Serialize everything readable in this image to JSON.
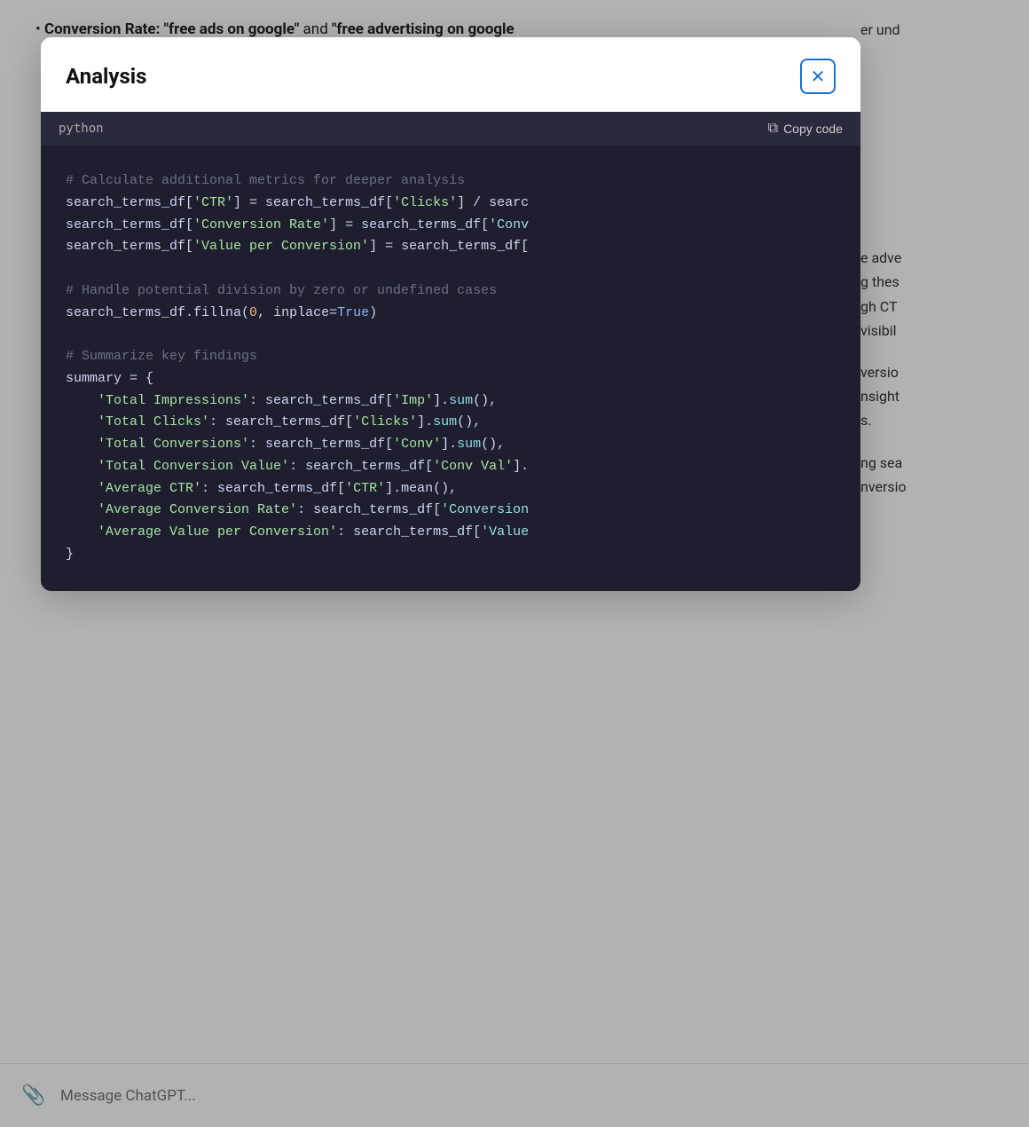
{
  "background": {
    "bullet_text": "Conversion Rate: \"free ads on google\" and \"free advertising on google\"",
    "right_snippets": [
      "e adve",
      "g thes",
      "gh CT",
      "visibil",
      "versio",
      "nsight",
      "s.",
      "ng sea",
      "nversio"
    ]
  },
  "modal": {
    "title": "Analysis",
    "close_label": "×",
    "code_header": {
      "lang": "python",
      "copy_label": "Copy code"
    },
    "code_lines": [
      {
        "type": "comment",
        "text": "# Calculate additional metrics for deeper analysis"
      },
      {
        "type": "mixed",
        "parts": [
          {
            "t": "default",
            "v": "search_terms_df["
          },
          {
            "t": "string-green",
            "v": "'CTR'"
          },
          {
            "t": "default",
            "v": "] = search_terms_df["
          },
          {
            "t": "string-green",
            "v": "'Clicks'"
          },
          {
            "t": "default",
            "v": "] / searc"
          }
        ]
      },
      {
        "type": "mixed",
        "parts": [
          {
            "t": "default",
            "v": "search_terms_df["
          },
          {
            "t": "string-green",
            "v": "'Conversion Rate'"
          },
          {
            "t": "default",
            "v": "] = search_terms_df["
          },
          {
            "t": "string-teal",
            "v": "'Conv"
          }
        ]
      },
      {
        "type": "mixed",
        "parts": [
          {
            "t": "default",
            "v": "search_terms_df["
          },
          {
            "t": "string-green",
            "v": "'Value per Conversion'"
          },
          {
            "t": "default",
            "v": "] = search_terms_df["
          }
        ]
      },
      {
        "type": "blank",
        "text": ""
      },
      {
        "type": "comment",
        "text": "# Handle potential division by zero or undefined cases"
      },
      {
        "type": "mixed",
        "parts": [
          {
            "t": "default",
            "v": "search_terms_df.fillna("
          },
          {
            "t": "orange",
            "v": "0"
          },
          {
            "t": "default",
            "v": ", inplace="
          },
          {
            "t": "keyword-blue",
            "v": "True"
          },
          {
            "t": "default",
            "v": ")"
          }
        ]
      },
      {
        "type": "blank",
        "text": ""
      },
      {
        "type": "comment",
        "text": "# Summarize key findings"
      },
      {
        "type": "default",
        "text": "summary = {"
      },
      {
        "type": "mixed",
        "parts": [
          {
            "t": "indent",
            "v": "    "
          },
          {
            "t": "string-green",
            "v": "'Total Impressions'"
          },
          {
            "t": "default",
            "v": ": search_terms_df["
          },
          {
            "t": "string-green",
            "v": "'Imp'"
          },
          {
            "t": "default",
            "v": "]."
          },
          {
            "t": "method",
            "v": "sum"
          },
          {
            "t": "default",
            "v": "(),"
          }
        ]
      },
      {
        "type": "mixed",
        "parts": [
          {
            "t": "indent",
            "v": "    "
          },
          {
            "t": "string-green",
            "v": "'Total Clicks'"
          },
          {
            "t": "default",
            "v": ": search_terms_df["
          },
          {
            "t": "string-green",
            "v": "'Clicks'"
          },
          {
            "t": "default",
            "v": "]."
          },
          {
            "t": "method",
            "v": "sum"
          },
          {
            "t": "default",
            "v": "(),"
          }
        ]
      },
      {
        "type": "mixed",
        "parts": [
          {
            "t": "indent",
            "v": "    "
          },
          {
            "t": "string-green",
            "v": "'Total Conversions'"
          },
          {
            "t": "default",
            "v": ": search_terms_df["
          },
          {
            "t": "string-green",
            "v": "'Conv'"
          },
          {
            "t": "default",
            "v": "]."
          },
          {
            "t": "method",
            "v": "sum"
          },
          {
            "t": "default",
            "v": "(),"
          }
        ]
      },
      {
        "type": "mixed",
        "parts": [
          {
            "t": "indent",
            "v": "    "
          },
          {
            "t": "string-green",
            "v": "'Total Conversion Value'"
          },
          {
            "t": "default",
            "v": ": search_terms_df["
          },
          {
            "t": "string-green",
            "v": "'Conv Val'"
          },
          {
            "t": "default",
            "v": "]."
          }
        ]
      },
      {
        "type": "mixed",
        "parts": [
          {
            "t": "indent",
            "v": "    "
          },
          {
            "t": "string-green",
            "v": "'Average CTR'"
          },
          {
            "t": "default",
            "v": ": search_terms_df["
          },
          {
            "t": "string-green",
            "v": "'CTR'"
          },
          {
            "t": "default",
            "v": "].mean(),"
          }
        ]
      },
      {
        "type": "mixed",
        "parts": [
          {
            "t": "indent",
            "v": "    "
          },
          {
            "t": "string-green",
            "v": "'Average Conversion Rate'"
          },
          {
            "t": "default",
            "v": ": search_terms_df["
          },
          {
            "t": "string-teal",
            "v": "'Conversion"
          }
        ]
      },
      {
        "type": "mixed",
        "parts": [
          {
            "t": "indent",
            "v": "    "
          },
          {
            "t": "string-green",
            "v": "'Average Value per Conversion'"
          },
          {
            "t": "default",
            "v": ": search_terms_df["
          },
          {
            "t": "string-teal",
            "v": "'Value"
          }
        ]
      },
      {
        "type": "default",
        "text": "}"
      }
    ]
  },
  "chat_input": {
    "placeholder": "Message ChatGPT...",
    "attach_icon": "📎"
  }
}
